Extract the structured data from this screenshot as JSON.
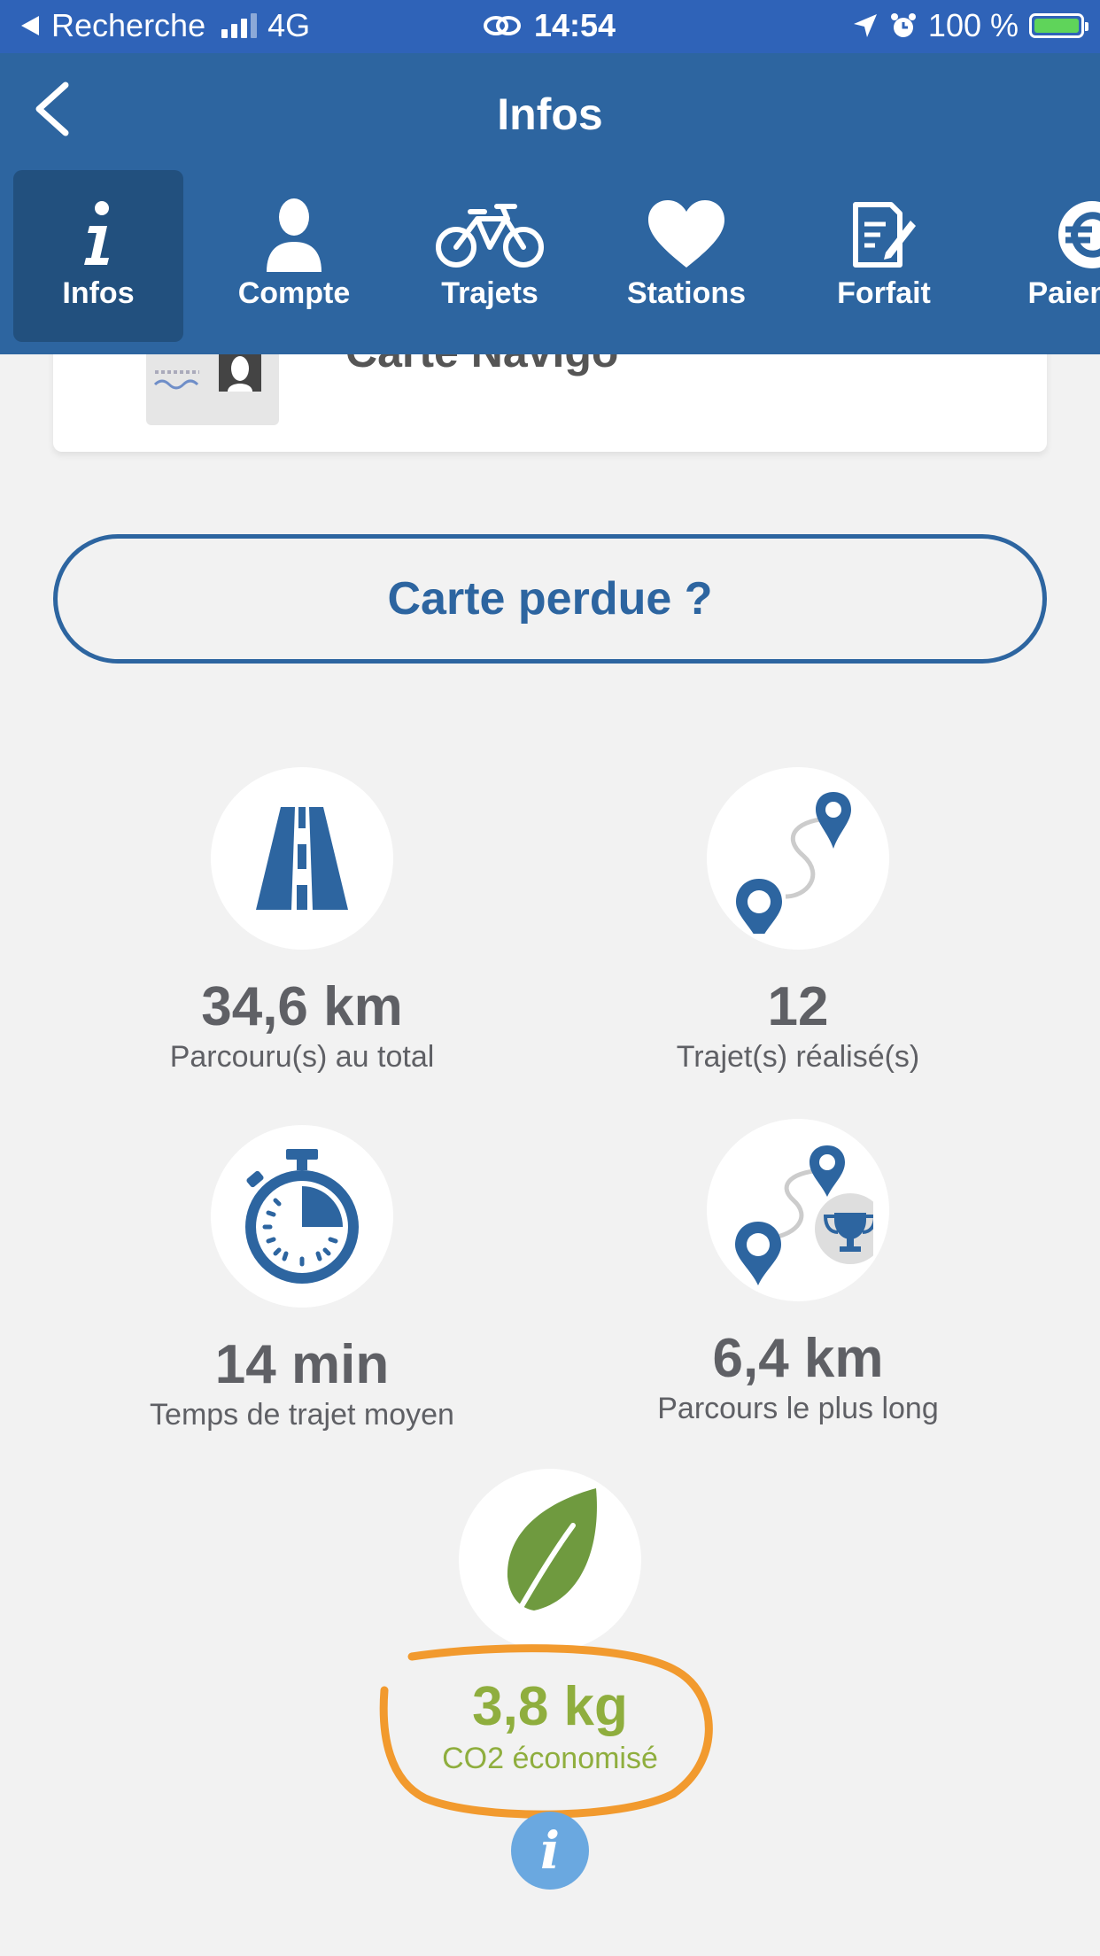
{
  "status_bar": {
    "back_app": "Recherche",
    "network": "4G",
    "time": "14:54",
    "battery": "100 %"
  },
  "header": {
    "title": "Infos",
    "tabs": [
      {
        "label": "Infos",
        "icon": "info-icon",
        "active": true
      },
      {
        "label": "Compte",
        "icon": "user-icon",
        "active": false
      },
      {
        "label": "Trajets",
        "icon": "bike-icon",
        "active": false
      },
      {
        "label": "Stations",
        "icon": "heart-icon",
        "active": false
      },
      {
        "label": "Forfait",
        "icon": "document-edit-icon",
        "active": false
      },
      {
        "label": "Paieme",
        "icon": "euro-icon",
        "active": false
      }
    ]
  },
  "card": {
    "title": "Carte Navigo"
  },
  "lost_card_button": "Carte perdue ?",
  "stats": [
    {
      "value": "34,6 km",
      "label": "Parcouru(s) au total",
      "icon": "road-icon"
    },
    {
      "value": "12",
      "label": "Trajet(s) réalisé(s)",
      "icon": "route-icon"
    },
    {
      "value": "14 min",
      "label": "Temps de trajet moyen",
      "icon": "stopwatch-icon"
    },
    {
      "value": "6,4 km",
      "label": "Parcours le plus long",
      "icon": "route-trophy-icon"
    }
  ],
  "co2": {
    "value": "3,8 kg",
    "label": "CO2 économisé",
    "icon": "leaf-icon"
  },
  "colors": {
    "status_bar": "#2f63b8",
    "header": "#2d65a0",
    "active_tab": "#22507e",
    "co2_green": "#8fae3e",
    "highlight_orange": "#f29a2e",
    "info_button": "#6aa8e0"
  }
}
